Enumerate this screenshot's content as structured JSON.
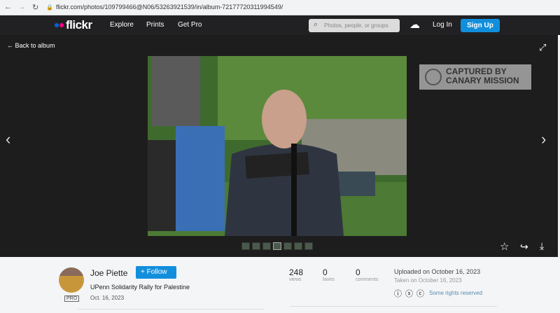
{
  "browser": {
    "url": "flickr.com/photos/109799466@N06/53263921539/in/album-72177720311994549/"
  },
  "nav": {
    "logo": "flickr",
    "items": [
      "Explore",
      "Prints",
      "Get Pro"
    ],
    "search_placeholder": "Photos, people, or groups",
    "login": "Log In",
    "signup": "Sign Up",
    "brand_colors": {
      "blue": "#0063dc",
      "pink": "#ff0084",
      "accent": "#128fdc"
    }
  },
  "viewer": {
    "back": "Back to album",
    "watermark": "CAPTURED BY CANARY MISSION",
    "thumbnail_count": 7
  },
  "info": {
    "author": "Joe Piette",
    "follow": "Follow",
    "badge": "PRO",
    "title": "UPenn Solidarity Rally for Palestine",
    "date": "Oct. 16, 2023",
    "stats": [
      {
        "value": "248",
        "label": "views"
      },
      {
        "value": "0",
        "label": "faves"
      },
      {
        "value": "0",
        "label": "comments"
      }
    ],
    "uploaded": "Uploaded on October 16, 2023",
    "taken": "Taken on October 16, 2023",
    "license": "Some rights reserved"
  }
}
